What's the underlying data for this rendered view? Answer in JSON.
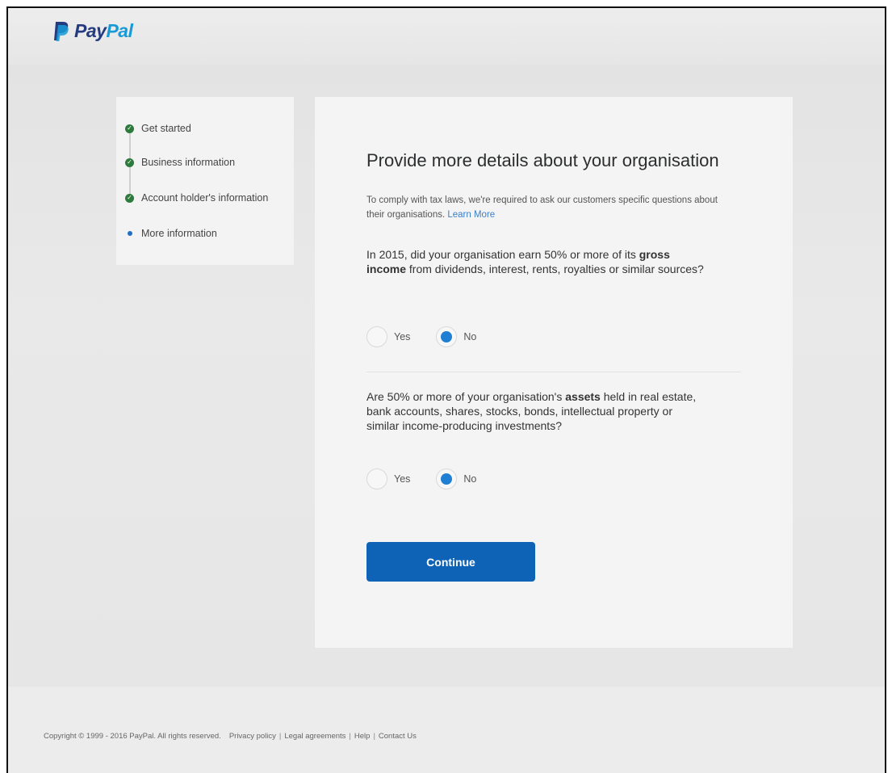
{
  "header": {
    "logo_text_pay": "Pay",
    "logo_text_pal": "Pal",
    "brand_colors": {
      "dark_blue": "#253b80",
      "light_blue": "#179bd7"
    }
  },
  "steps": [
    {
      "label": "Get started",
      "status": "complete"
    },
    {
      "label": "Business information",
      "status": "complete"
    },
    {
      "label": "Account holder's information",
      "status": "complete"
    },
    {
      "label": "More information",
      "status": "current"
    }
  ],
  "form": {
    "title": "Provide more details about your organisation",
    "intro_text": "To comply with tax laws, we're required to ask our customers specific questions about their organisations.",
    "intro_link": "Learn More",
    "question1": {
      "part1": "In 2015, did your organisation earn 50% or more of its ",
      "bold": "gross income",
      "part2": " from dividends, interest, rents, royalties or similar sources?",
      "options": [
        "Yes",
        "No"
      ],
      "selected": "No"
    },
    "question2": {
      "part1": "Are 50% or more of your organisation's ",
      "bold": "assets",
      "part2": " held in real estate, bank accounts, shares, stocks, bonds, intellectual property or similar income-producing investments?",
      "options": [
        "Yes",
        "No"
      ],
      "selected": "No"
    },
    "continue_label": "Continue",
    "accent_color": "#0f63b6"
  },
  "footer": {
    "copyright": "Copyright © 1999 - 2016 PayPal. All rights reserved.",
    "links": [
      "Privacy policy",
      "Legal agreements",
      "Help",
      "Contact Us"
    ]
  }
}
